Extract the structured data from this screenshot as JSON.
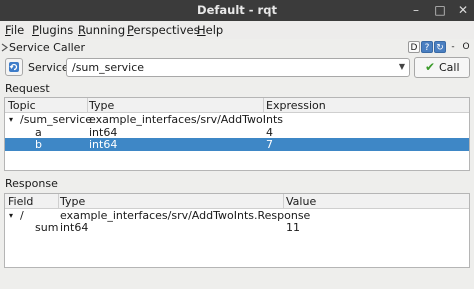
{
  "window": {
    "title": "Default - rqt",
    "min_glyph": "–",
    "max_glyph": "□",
    "close_glyph": "✕"
  },
  "menu": {
    "items": [
      {
        "label": "File",
        "accel": "F",
        "rest": "ile"
      },
      {
        "label": "Plugins",
        "accel": "P",
        "rest": "lugins"
      },
      {
        "label": "Running",
        "accel": "R",
        "rest": "unning"
      },
      {
        "label": "Perspectives",
        "accel": "P",
        "rest": "erspectives"
      },
      {
        "label": "Help",
        "accel": "H",
        "rest": "elp"
      }
    ]
  },
  "dock": {
    "title": "Service Caller",
    "icons": [
      "D",
      "?",
      "↻",
      "-",
      "O"
    ]
  },
  "toolbar": {
    "service_label": "Service",
    "service_value": "/sum_service",
    "call_label": "Call"
  },
  "request": {
    "label": "Request",
    "headers": [
      "Topic",
      "Type",
      "Expression"
    ],
    "rows": [
      {
        "topic": "/sum_service",
        "type": "example_interfaces/srv/AddTwoInts",
        "expression": "",
        "expanded": true
      },
      {
        "topic": "a",
        "type": "int64",
        "expression": "4"
      },
      {
        "topic": "b",
        "type": "int64",
        "expression": "7",
        "selected": true
      }
    ]
  },
  "response": {
    "label": "Response",
    "headers": [
      "Field",
      "Type",
      "Value"
    ],
    "rows": [
      {
        "field": "/",
        "type": "example_interfaces/srv/AddTwoInts.Response",
        "value": "",
        "expanded": true
      },
      {
        "field": "sum",
        "type": "int64",
        "value": "11"
      }
    ]
  },
  "colors": {
    "titlebar": "#3b3b3b",
    "selection": "#3e87c6",
    "call_check": "#3a9a2a"
  }
}
